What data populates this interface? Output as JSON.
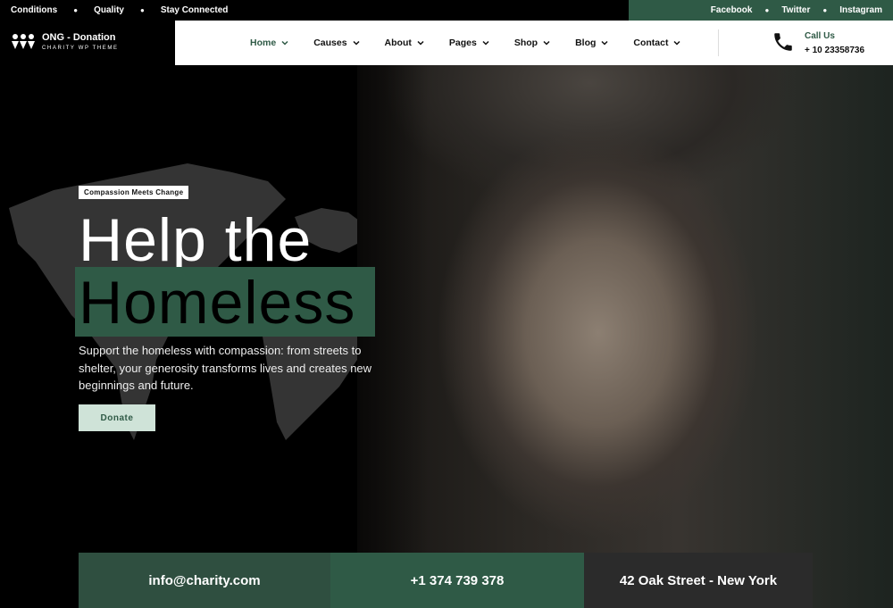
{
  "topbar": {
    "left_links": [
      "Conditions",
      "Quality",
      "Stay Connected"
    ],
    "social_links": [
      "Facebook",
      "Twitter",
      "Instagram"
    ]
  },
  "logo": {
    "title": "ONG - Donation",
    "subtitle": "CHARITY WP THEME",
    "icon": "hands-heart-icon"
  },
  "nav": {
    "items": [
      {
        "label": "Home",
        "active": true
      },
      {
        "label": "Causes",
        "active": false
      },
      {
        "label": "About",
        "active": false
      },
      {
        "label": "Pages",
        "active": false
      },
      {
        "label": "Shop",
        "active": false
      },
      {
        "label": "Blog",
        "active": false
      },
      {
        "label": "Contact",
        "active": false
      }
    ]
  },
  "call": {
    "label": "Call Us",
    "number": "+ 10 23358736",
    "icon": "phone-icon"
  },
  "hero": {
    "badge": "Compassion Meets Change",
    "headline_line1": "Help the",
    "headline_line2": "Homeless",
    "description": "Support the homeless with compassion: from streets to shelter, your generosity transforms lives and creates new beginnings and future.",
    "button": "Donate"
  },
  "contact_strip": {
    "email": "info@charity.com",
    "phone": "+1 374 739 378",
    "address": "42 Oak Street - New York"
  },
  "colors": {
    "accent": "#2f5a46",
    "button_bg": "#cfe3d8",
    "background": "#000000"
  }
}
